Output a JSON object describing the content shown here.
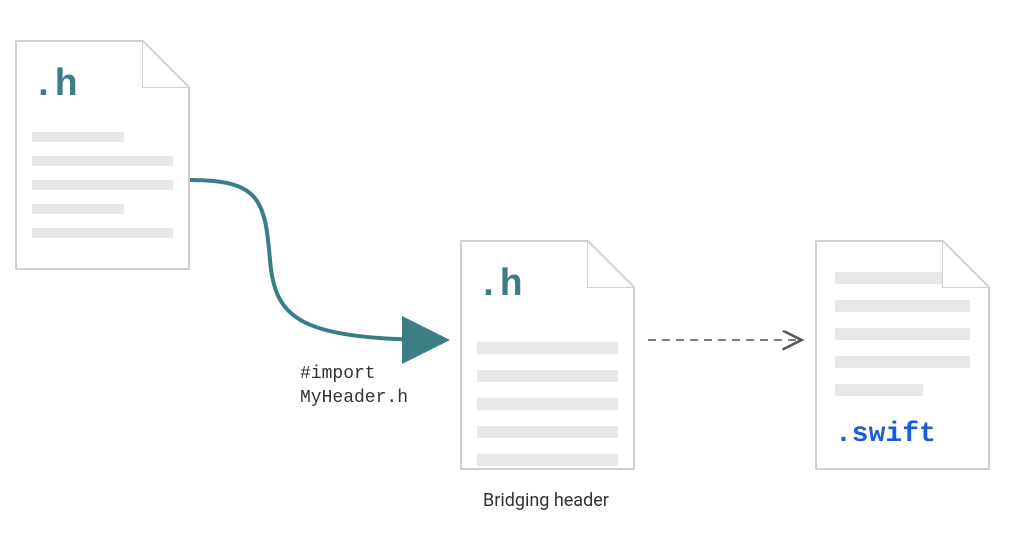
{
  "files": {
    "header": {
      "extension": ".h",
      "lines": [
        "short",
        "full",
        "full",
        "short",
        "full"
      ]
    },
    "bridging": {
      "extension": ".h",
      "caption": "Bridging header",
      "lines": [
        "full",
        "full",
        "full",
        "full",
        "full"
      ]
    },
    "swift": {
      "extension": ".swift",
      "lines": [
        "full",
        "full",
        "full",
        "full",
        "short"
      ]
    }
  },
  "arrows": {
    "import_statement": "#import\nMyHeader.h"
  },
  "colors": {
    "teal": "#3b7d84",
    "swift_blue": "#1a5dd6",
    "line_gray": "#d0d0d0",
    "placeholder_gray": "#e7e7e7"
  }
}
